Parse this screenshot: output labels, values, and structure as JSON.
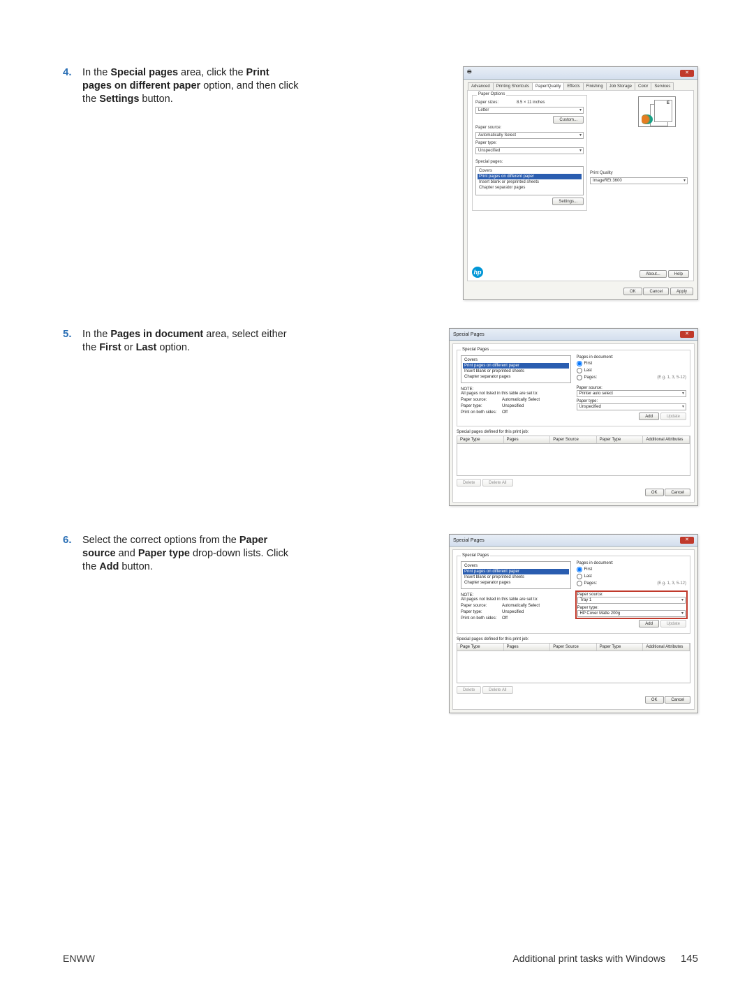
{
  "steps": {
    "s4": {
      "num": "4.",
      "pre1": "In the ",
      "b1": "Special pages",
      "mid1": " area, click the ",
      "b2": "Print pages on different paper",
      "mid2": " option, and then click the ",
      "b3": "Settings",
      "post": " button."
    },
    "s5": {
      "num": "5.",
      "pre1": "In the ",
      "b1": "Pages in document",
      "mid1": " area, select either the ",
      "b2": "First",
      "mid2": " or ",
      "b3": "Last",
      "post": " option."
    },
    "s6": {
      "num": "6.",
      "pre1": "Select the correct options from the ",
      "b1": "Paper source",
      "mid1": " and ",
      "b2": "Paper type",
      "mid2": " drop-down lists. Click the ",
      "b3": "Add",
      "post": " button."
    }
  },
  "dlg1": {
    "tabs": [
      "Advanced",
      "Printing Shortcuts",
      "Paper/Quality",
      "Effects",
      "Finishing",
      "Job Storage",
      "Color",
      "Services"
    ],
    "activeTab": "Paper/Quality",
    "paperOptions": "Paper Options",
    "paperSizesLbl": "Paper sizes:",
    "paperSizesVal": "8.5 × 11 inches",
    "sizeSel": "Letter",
    "customBtn": "Custom...",
    "paperSourceLbl": "Paper source:",
    "paperSourceSel": "Automatically Select",
    "paperTypeLbl": "Paper type:",
    "paperTypeSel": "Unspecified",
    "specialLbl": "Special pages:",
    "specialItems": [
      "Covers",
      "Print pages on different paper",
      "Insert blank or preprinted sheets",
      "Chapter separator pages"
    ],
    "settingsBtn": "Settings...",
    "printQualityLbl": "Print Quality",
    "printQualitySel": "ImageREt 3600",
    "aboutBtn": "About...",
    "helpBtn": "Help",
    "okBtn": "OK",
    "cancelBtn": "Cancel",
    "applyBtn": "Apply",
    "previewE": "E"
  },
  "dlg2": {
    "title": "Special Pages",
    "groupTitle": "Special Pages",
    "listItems": [
      "Covers",
      "Print pages on different paper",
      "Insert blank or preprinted sheets",
      "Chapter separator pages"
    ],
    "pagesInDocLbl": "Pages in document:",
    "radioFirst": "First",
    "radioLast": "Last",
    "radioPages": "Pages:",
    "pagesEg": "(E.g. 1, 3, 5-12)",
    "noteHdr": "NOTE:",
    "noteText": "All pages not listed in this table are set to:",
    "psLbl": "Paper source:",
    "psVal": "Automatically Select",
    "ptLbl": "Paper type:",
    "ptVal": "Unspecified",
    "bothLbl": "Print on both sides:",
    "bothVal": "Off",
    "rightPsLbl": "Paper source:",
    "rightPsSel": "Printer auto select",
    "rightPsSel_step6": "Tray 1",
    "rightPtLbl": "Paper type:",
    "rightPtSel": "Unspecified",
    "rightPtSel_step6": "HP Cover Matte 200g",
    "addBtn": "Add",
    "updateBtn": "Update",
    "definedLbl": "Special pages defined for this print job:",
    "cols": [
      "Page Type",
      "Pages",
      "Paper Source",
      "Paper Type",
      "Additional Attributes"
    ],
    "deleteBtn": "Delete",
    "deleteAllBtn": "Delete All",
    "okBtn": "OK",
    "cancelBtn": "Cancel"
  },
  "footer": {
    "left": "ENWW",
    "right": "Additional print tasks with Windows",
    "page": "145"
  }
}
